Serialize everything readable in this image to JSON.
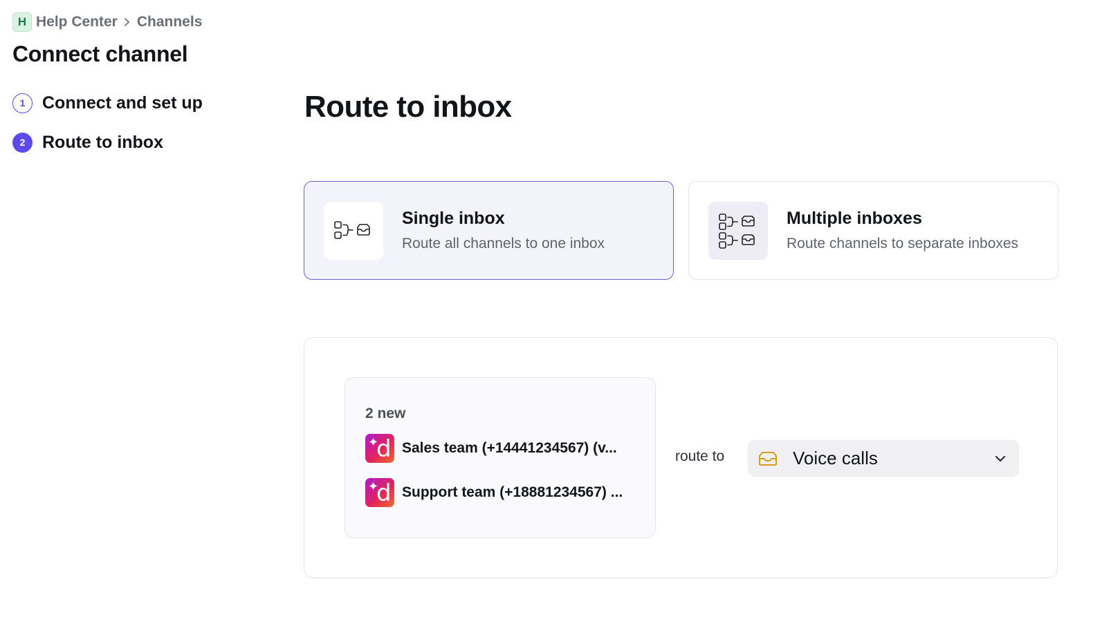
{
  "breadcrumb": {
    "badge": "H",
    "items": [
      "Help Center",
      "Channels"
    ]
  },
  "page_title": "Connect channel",
  "steps": [
    {
      "number": "1",
      "label": "Connect and set up",
      "state": "done"
    },
    {
      "number": "2",
      "label": "Route to inbox",
      "state": "active"
    }
  ],
  "section_title": "Route to inbox",
  "options": {
    "single": {
      "title": "Single inbox",
      "description": "Route all channels to one inbox",
      "selected": true,
      "icon": "single-route-icon"
    },
    "multiple": {
      "title": "Multiple inboxes",
      "description": "Route channels to separate inboxes",
      "selected": false,
      "icon": "multi-route-icon"
    }
  },
  "routing": {
    "new_count": "2 new",
    "channels": [
      {
        "name": "Sales team (+14441234567) (v...",
        "icon": "dialpad-logo"
      },
      {
        "name": "Support team (+18881234567) ...",
        "icon": "dialpad-logo"
      }
    ],
    "route_to_label": "route to",
    "selected_inbox": "Voice calls",
    "inbox_icon": "inbox-tray-icon"
  },
  "colors": {
    "accent": "#5b4be8",
    "selected_border": "#6a5fd8",
    "selected_bg": "#f3f3fb",
    "inbox_icon": "#d69a1e"
  }
}
